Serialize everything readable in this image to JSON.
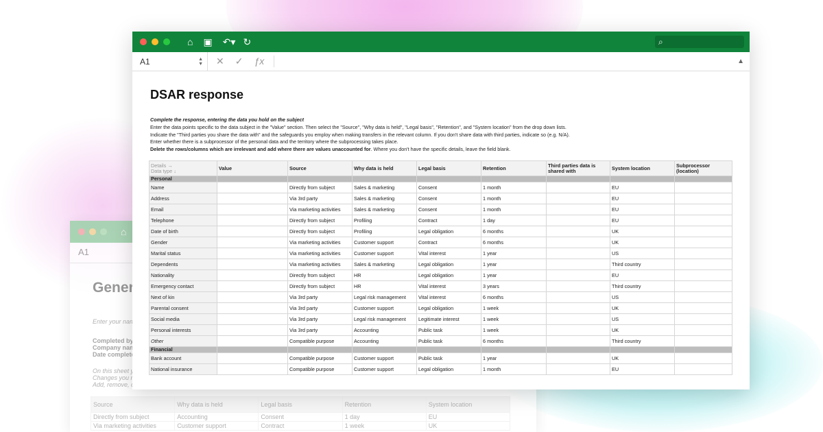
{
  "back_window": {
    "cell_ref": "A1",
    "title": "Gener",
    "subtitle": "Enter your nam",
    "meta": [
      "Completed by",
      "Company nam",
      "Date complete"
    ],
    "notes": [
      "On this sheet y",
      "Changes you n",
      "Add, remove, c"
    ],
    "columns": [
      "Source",
      "Why data is held",
      "Legal basis",
      "Retention",
      "System location"
    ],
    "rows": [
      [
        "Directly from subject",
        "Accounting",
        "Consent",
        "1 day",
        "EU"
      ],
      [
        "Via marketing activities",
        "Customer support",
        "Contract",
        "1 week",
        "UK"
      ]
    ]
  },
  "front_window": {
    "cell_ref": "A1",
    "icons": [
      "home-icon",
      "save-icon",
      "undo-icon",
      "refresh-icon",
      "search-icon",
      "cancel-icon",
      "check-icon",
      "function-icon"
    ],
    "fx": "ƒx",
    "title": "DSAR response",
    "instructions": {
      "heading": "Complete the response, entering the data you hold on the subject",
      "line1": "Enter the data points specific to the data subject in the \"Value\" section. Then select the \"Source\", \"Why data is held\", \"Legal basis\", \"Retention\", and \"System location\" from the drop down lists.",
      "line2": "Indicate the \"Third parties you share the data with\" and the safeguards you employ when making transfers in the relevant column. If you don't share data with third parties, indicate so (e.g. N/A).",
      "line3": "Enter whether there is a subprocessor of the personal data and the territory where the subprocessing takes place.",
      "line4_bold": "Delete the rows/columns which are irrelevant and add where there are values unaccounted for",
      "line4_rest": ". Where you don't have the specific details, leave the field blank."
    },
    "table": {
      "corner": [
        "Details →",
        "Data type ↓"
      ],
      "columns": [
        "Value",
        "Source",
        "Why data is held",
        "Legal basis",
        "Retention",
        "Third parties data is shared with",
        "System location",
        "Subprocessor (location)"
      ],
      "sections": [
        {
          "name": "Personal",
          "rows": [
            [
              "Name",
              "",
              "Directly from subject",
              "Sales & marketing",
              "Consent",
              "1 month",
              "",
              "EU",
              ""
            ],
            [
              "Address",
              "",
              "Via 3rd party",
              "Sales & marketing",
              "Consent",
              "1 month",
              "",
              "EU",
              ""
            ],
            [
              "Email",
              "",
              "Via marketing activities",
              "Sales & marketing",
              "Consent",
              "1 month",
              "",
              "EU",
              ""
            ],
            [
              "Telephone",
              "",
              "Directly from subject",
              "Profiling",
              "Contract",
              "1 day",
              "",
              "EU",
              ""
            ],
            [
              "Date of birth",
              "",
              "Directly from subject",
              "Profiling",
              "Legal obligation",
              "6 months",
              "",
              "UK",
              ""
            ],
            [
              "Gender",
              "",
              "Via marketing activities",
              "Customer support",
              "Contract",
              "6 months",
              "",
              "UK",
              ""
            ],
            [
              "Marital status",
              "",
              "Via marketing activities",
              "Customer support",
              "Vital interest",
              "1 year",
              "",
              "US",
              ""
            ],
            [
              "Dependents",
              "",
              "Via marketing activities",
              "Sales & marketing",
              "Legal obligation",
              "1 year",
              "",
              "Third country",
              ""
            ],
            [
              "Nationality",
              "",
              "Directly from subject",
              "HR",
              "Legal obligation",
              "1 year",
              "",
              "EU",
              ""
            ],
            [
              "Emergency contact",
              "",
              "Directly from subject",
              "HR",
              "Vital interest",
              "3 years",
              "",
              "Third country",
              ""
            ],
            [
              "Next of kin",
              "",
              "Via 3rd party",
              "Legal risk management",
              "Vital interest",
              "6 months",
              "",
              "US",
              ""
            ],
            [
              "Parental consent",
              "",
              "Via 3rd party",
              "Customer support",
              "Legal obligation",
              "1 week",
              "",
              "UK",
              ""
            ],
            [
              "Social media",
              "",
              "Via 3rd party",
              "Legal risk management",
              "Legitimate interest",
              "1 week",
              "",
              "US",
              ""
            ],
            [
              "Personal interests",
              "",
              "Via 3rd party",
              "Accounting",
              "Public task",
              "1 week",
              "",
              "UK",
              ""
            ],
            [
              "Other",
              "",
              "Compatible purpose",
              "Accounting",
              "Public task",
              "6 months",
              "",
              "Third country",
              ""
            ]
          ]
        },
        {
          "name": "Financial",
          "rows": [
            [
              "Bank account",
              "",
              "Compatible purpose",
              "Customer support",
              "Public task",
              "1 year",
              "",
              "UK",
              ""
            ],
            [
              "National insurance",
              "",
              "Compatible purpose",
              "Customer support",
              "Legal obligation",
              "1 month",
              "",
              "EU",
              ""
            ]
          ]
        }
      ]
    }
  },
  "colors": {
    "titlebar": "#10843b",
    "back_titlebar": "#8fcf9e",
    "section_band": "#bdbdbd"
  }
}
